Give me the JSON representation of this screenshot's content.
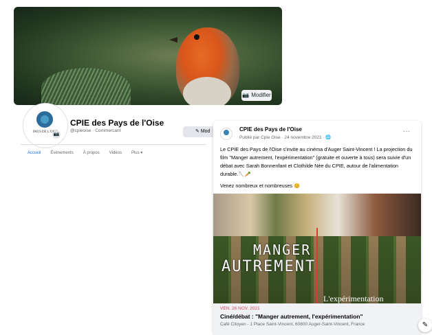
{
  "cover": {
    "modify_label": "Modifier",
    "camera_icon": "camera-icon"
  },
  "profile": {
    "avatar_text": "PAYS DE L'OISE",
    "name": "CPIE des Pays de l'Oise",
    "handle": "@cpieoise · Commercant",
    "message_button": "Mod"
  },
  "tabs": [
    {
      "label": "Accueil",
      "active": true
    },
    {
      "label": "Évènements"
    },
    {
      "label": "À propos"
    },
    {
      "label": "Vidéos"
    },
    {
      "label": "Plus ▾"
    }
  ],
  "post": {
    "author": "CPIE des Pays de l'Oise",
    "meta": "Publié par Cpie Oise · 24 novembre 2021 · 🌐",
    "more": "···",
    "text1": "Le CPIE des Pays de l'Oise s'invite au cinéma d'Auger Saint-Vincent ! La projection du film \"Manger autrement, l'expérimentation\" (gratuite et ouverte à tous) sera suivie d'un débat avec Sarah Bonnenfant et Clothilde Née du CPIE, autour de l'alimentation durable.🥄🥕",
    "text2": "Venez nombreux et nombreuses 😊",
    "image_title1": "MANGER",
    "image_title2": "AUTREMENT",
    "image_subtitle": "L'expérimentation"
  },
  "event": {
    "date": "VEN. 26 NOV. 2021",
    "title": "Ciné/débat : \"Manger autrement, l'expérimentation\"",
    "place": "Café Citoyen - 1 Place Saint-Vincent, 60800 Auger-Saint-Vincent, France"
  },
  "fab_icon": "edit-icon"
}
